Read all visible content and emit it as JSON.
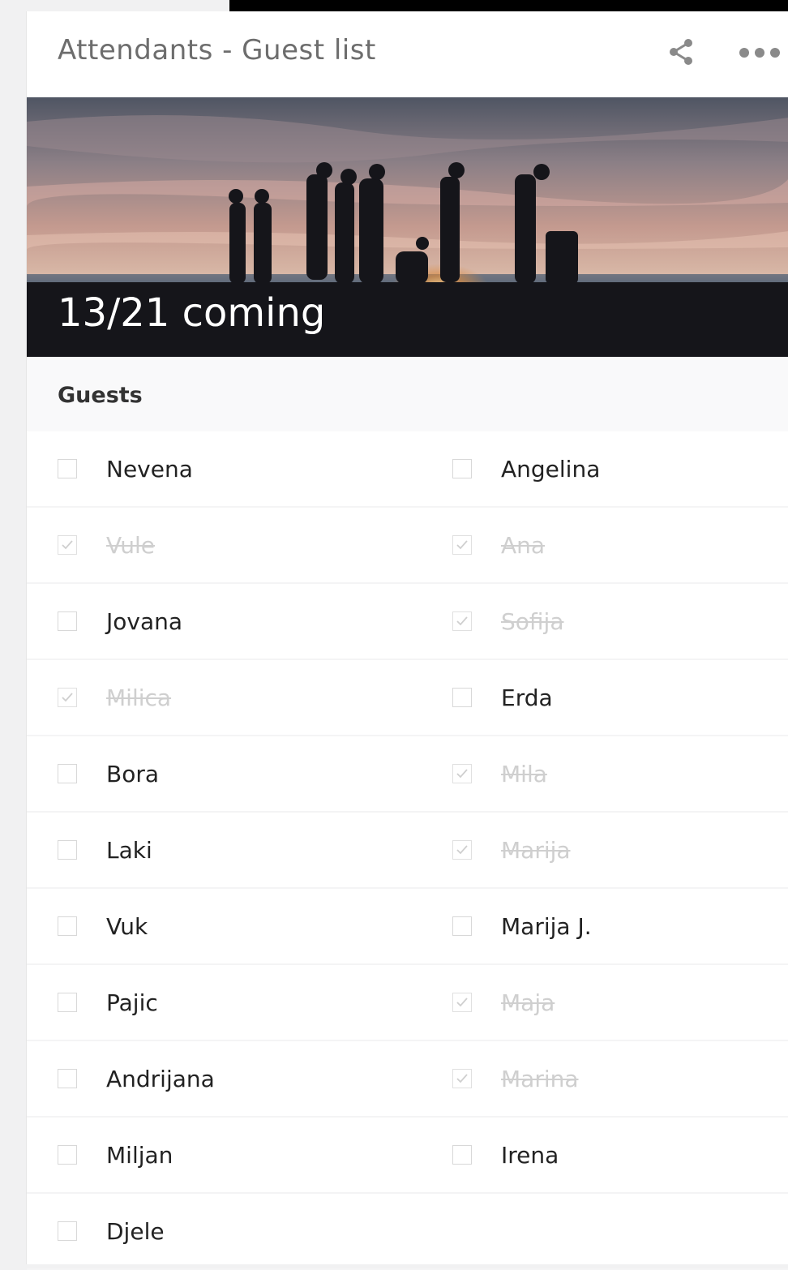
{
  "card": {
    "title": "Attendants - Guest list",
    "share_icon": "share-icon",
    "more_icon": "more-horizontal-icon"
  },
  "hero": {
    "count_text": "13/21 coming"
  },
  "guests": {
    "section_title": "Guests",
    "rows": [
      [
        {
          "name": "Nevena",
          "checked": false
        },
        {
          "name": "Angelina",
          "checked": false
        }
      ],
      [
        {
          "name": "Vule",
          "checked": true
        },
        {
          "name": "Ana",
          "checked": true
        }
      ],
      [
        {
          "name": "Jovana",
          "checked": false
        },
        {
          "name": "Sofija",
          "checked": true
        }
      ],
      [
        {
          "name": "Milica",
          "checked": true
        },
        {
          "name": "Erda",
          "checked": false
        }
      ],
      [
        {
          "name": "Bora",
          "checked": false
        },
        {
          "name": "Mila",
          "checked": true
        }
      ],
      [
        {
          "name": "Laki",
          "checked": false
        },
        {
          "name": "Marija",
          "checked": true
        }
      ],
      [
        {
          "name": "Vuk",
          "checked": false
        },
        {
          "name": "Marija J.",
          "checked": false
        }
      ],
      [
        {
          "name": "Pajic",
          "checked": false
        },
        {
          "name": "Maja",
          "checked": true
        }
      ],
      [
        {
          "name": "Andrijana",
          "checked": false
        },
        {
          "name": "Marina",
          "checked": true
        }
      ],
      [
        {
          "name": "Miljan",
          "checked": false
        },
        {
          "name": "Irena",
          "checked": false
        }
      ],
      [
        {
          "name": "Djele",
          "checked": false
        }
      ]
    ]
  }
}
